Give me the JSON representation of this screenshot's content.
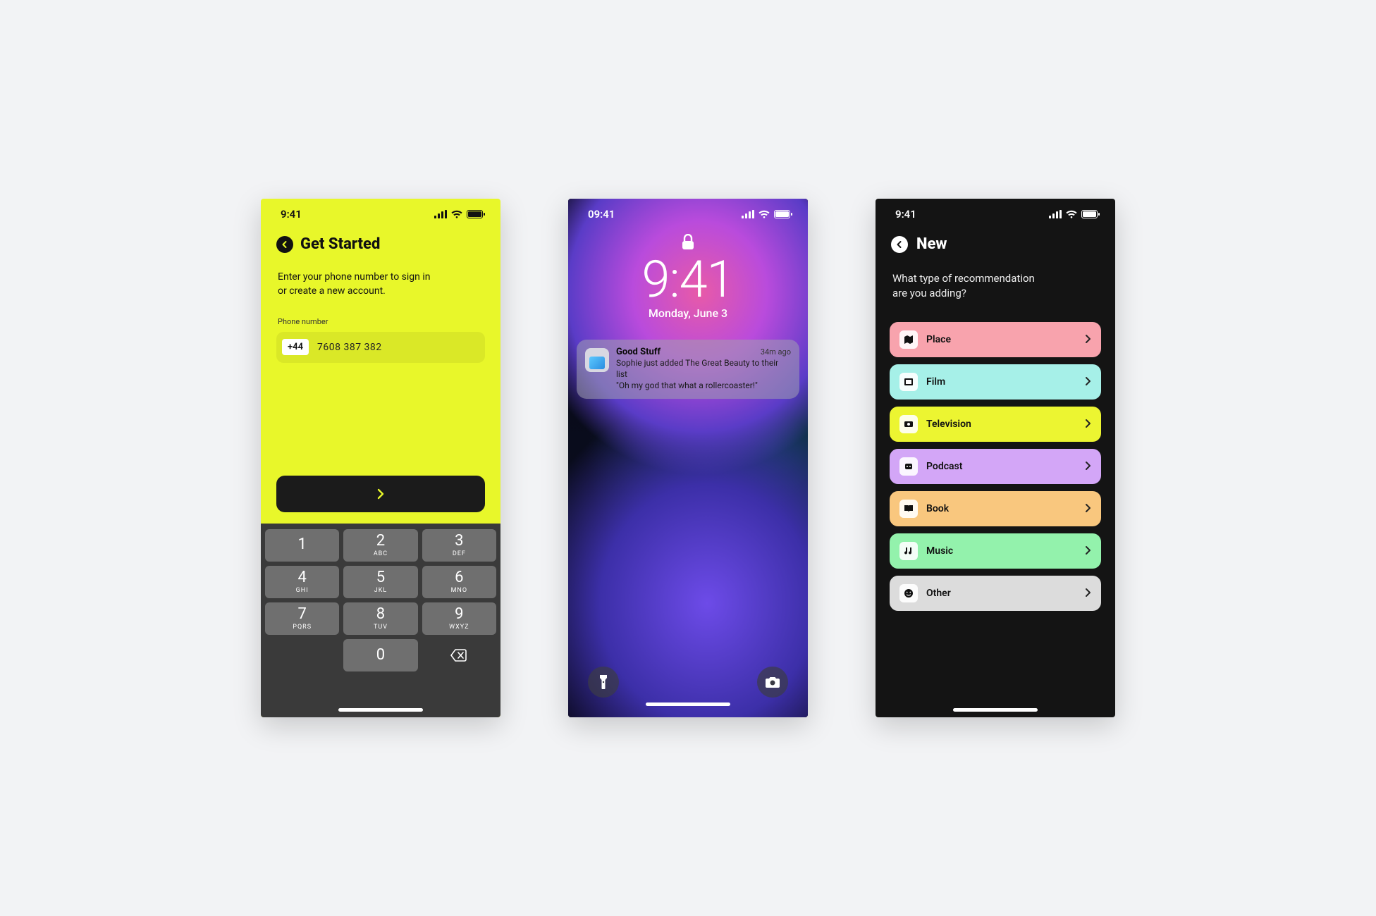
{
  "screen1": {
    "status_time": "9:41",
    "title": "Get Started",
    "subtitle": "Enter your phone number to sign in or create a new account.",
    "field_label": "Phone number",
    "country_code": "+44",
    "phone_value": "7608 387 382",
    "keypad": [
      {
        "digit": "1",
        "letters": ""
      },
      {
        "digit": "2",
        "letters": "ABC"
      },
      {
        "digit": "3",
        "letters": "DEF"
      },
      {
        "digit": "4",
        "letters": "GHI"
      },
      {
        "digit": "5",
        "letters": "JKL"
      },
      {
        "digit": "6",
        "letters": "MNO"
      },
      {
        "digit": "7",
        "letters": "PQRS"
      },
      {
        "digit": "8",
        "letters": "TUV"
      },
      {
        "digit": "9",
        "letters": "WXYZ"
      },
      {
        "digit": "0",
        "letters": ""
      }
    ]
  },
  "screen2": {
    "status_time": "09:41",
    "lock_time": "9:41",
    "lock_date": "Monday, June 3",
    "notification": {
      "app": "Good Stuff",
      "time": "34m ago",
      "line1": "Sophie just added The Great Beauty to their list",
      "line2": "\"Oh my god that what a rollercoaster!\""
    }
  },
  "screen3": {
    "status_time": "9:41",
    "title": "New",
    "subtitle": "What type of recommendation are you adding?",
    "categories": [
      {
        "label": "Place",
        "color": "#f8a3ad",
        "icon": "map"
      },
      {
        "label": "Film",
        "color": "#a6f0e8",
        "icon": "film"
      },
      {
        "label": "Television",
        "color": "#ecf531",
        "icon": "tv"
      },
      {
        "label": "Podcast",
        "color": "#d3a6f7",
        "icon": "podcast"
      },
      {
        "label": "Book",
        "color": "#f9c77e",
        "icon": "book"
      },
      {
        "label": "Music",
        "color": "#93f2ac",
        "icon": "music"
      },
      {
        "label": "Other",
        "color": "#dcdcdc",
        "icon": "other"
      }
    ]
  }
}
